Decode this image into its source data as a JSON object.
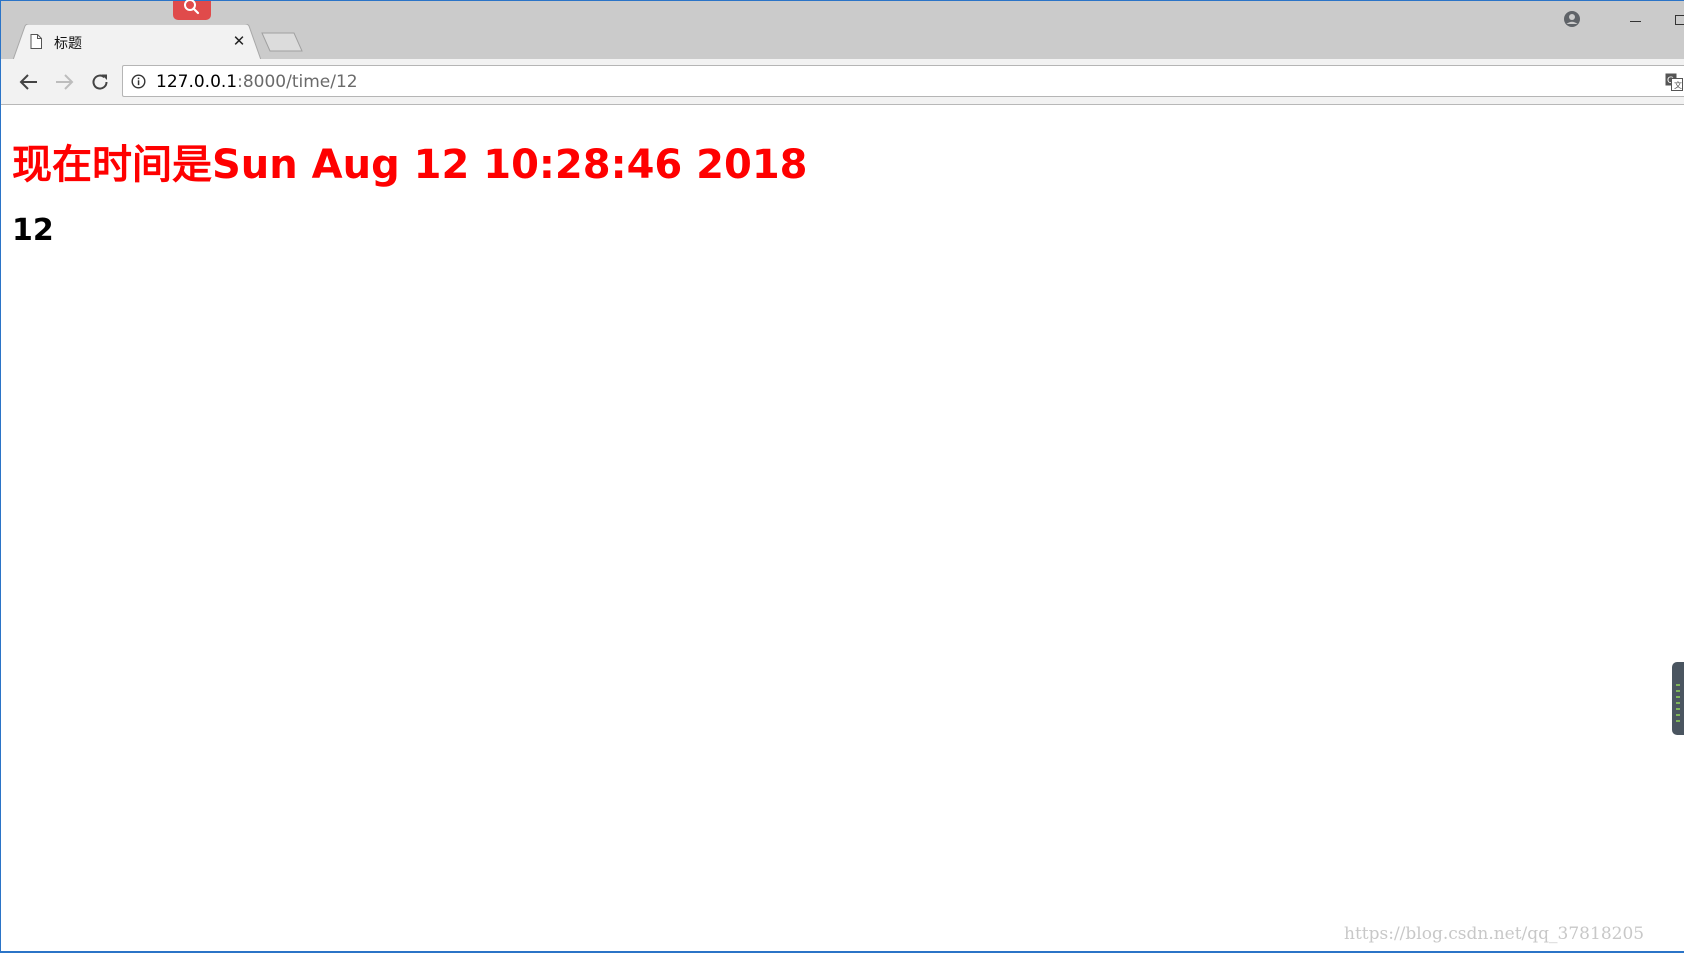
{
  "browser": {
    "tab": {
      "title": "标题",
      "close_glyph": "✕",
      "icon": "document-icon"
    },
    "extension_icon": "search-extension-icon",
    "profile_icon": "account-circle-icon",
    "toolbar": {
      "back_icon": "arrow-left-icon",
      "forward_icon": "arrow-right-icon",
      "reload_icon": "reload-icon"
    },
    "omnibox": {
      "info_icon": "info-icon",
      "url_host": "127.0.0.1",
      "url_rest": ":8000/time/12",
      "translate_icon": "translate-icon"
    }
  },
  "page": {
    "heading": "现在时间是Sun Aug 12 10:28:46 2018",
    "subheading": "12",
    "heading_color": "#ff0000"
  },
  "watermark": "https://blog.csdn.net/qq_37818205"
}
